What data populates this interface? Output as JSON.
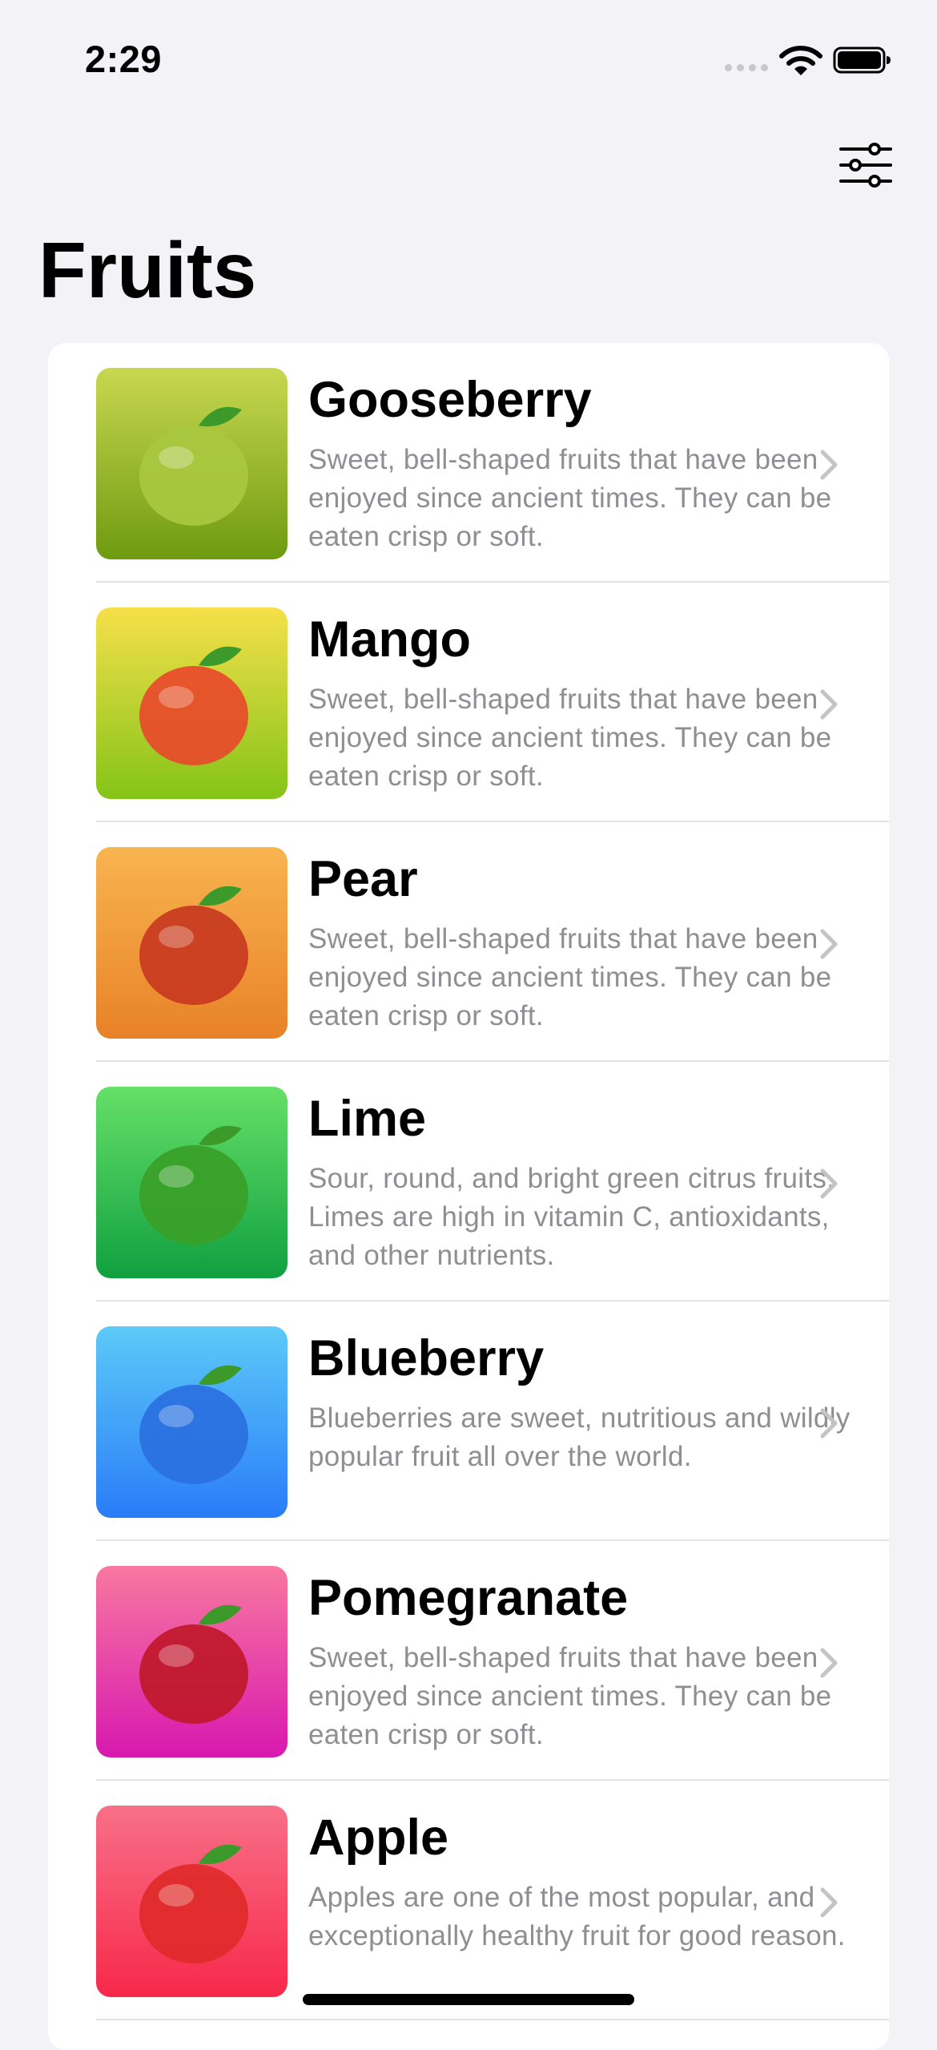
{
  "status_bar": {
    "time": "2:29",
    "icons": [
      "cellular-signal-icon",
      "wifi-icon",
      "battery-icon"
    ]
  },
  "toolbar": {
    "filter_icon": "sliders-filter-icon"
  },
  "header": {
    "title": "Fruits"
  },
  "fruits": [
    {
      "name": "Gooseberry",
      "description": "Sweet, bell-shaped fruits that have been enjoyed since ancient times. They can be eaten crisp or soft.",
      "bg_top": "#c8d850",
      "bg_bottom": "#6e9a10",
      "fruit_color": "#a8c840"
    },
    {
      "name": "Mango",
      "description": "Sweet, bell-shaped fruits that have been enjoyed since ancient times. They can be eaten crisp or soft.",
      "bg_top": "#f6e04a",
      "bg_bottom": "#84c418",
      "fruit_color": "#e84a2a"
    },
    {
      "name": "Pear",
      "description": "Sweet, bell-shaped fruits that have been enjoyed since ancient times. They can be eaten crisp or soft.",
      "bg_top": "#f8b450",
      "bg_bottom": "#e88228",
      "fruit_color": "#c83a20"
    },
    {
      "name": "Lime",
      "description": "Sour, round, and bright green citrus fruits. Limes are high in vitamin C, antioxidants, and other nutrients.",
      "bg_top": "#66e068",
      "bg_bottom": "#10a040",
      "fruit_color": "#3aa028"
    },
    {
      "name": "Blueberry",
      "description": "Blueberries are sweet, nutritious and wildly popular fruit all over the world.",
      "bg_top": "#5ccaf8",
      "bg_bottom": "#2a7cf8",
      "fruit_color": "#2a70e0"
    },
    {
      "name": "Pomegranate",
      "description": "Sweet, bell-shaped fruits that have been enjoyed since ancient times. They can be eaten crisp or soft.",
      "bg_top": "#f878a0",
      "bg_bottom": "#d818b0",
      "fruit_color": "#c0182a"
    },
    {
      "name": "Apple",
      "description": "Apples are one of the most popular, and exceptionally healthy fruit for good reason.",
      "bg_top": "#f87088",
      "bg_bottom": "#f8284a",
      "fruit_color": "#e02a2a"
    }
  ],
  "chevron_icon": "chevron-right-icon"
}
